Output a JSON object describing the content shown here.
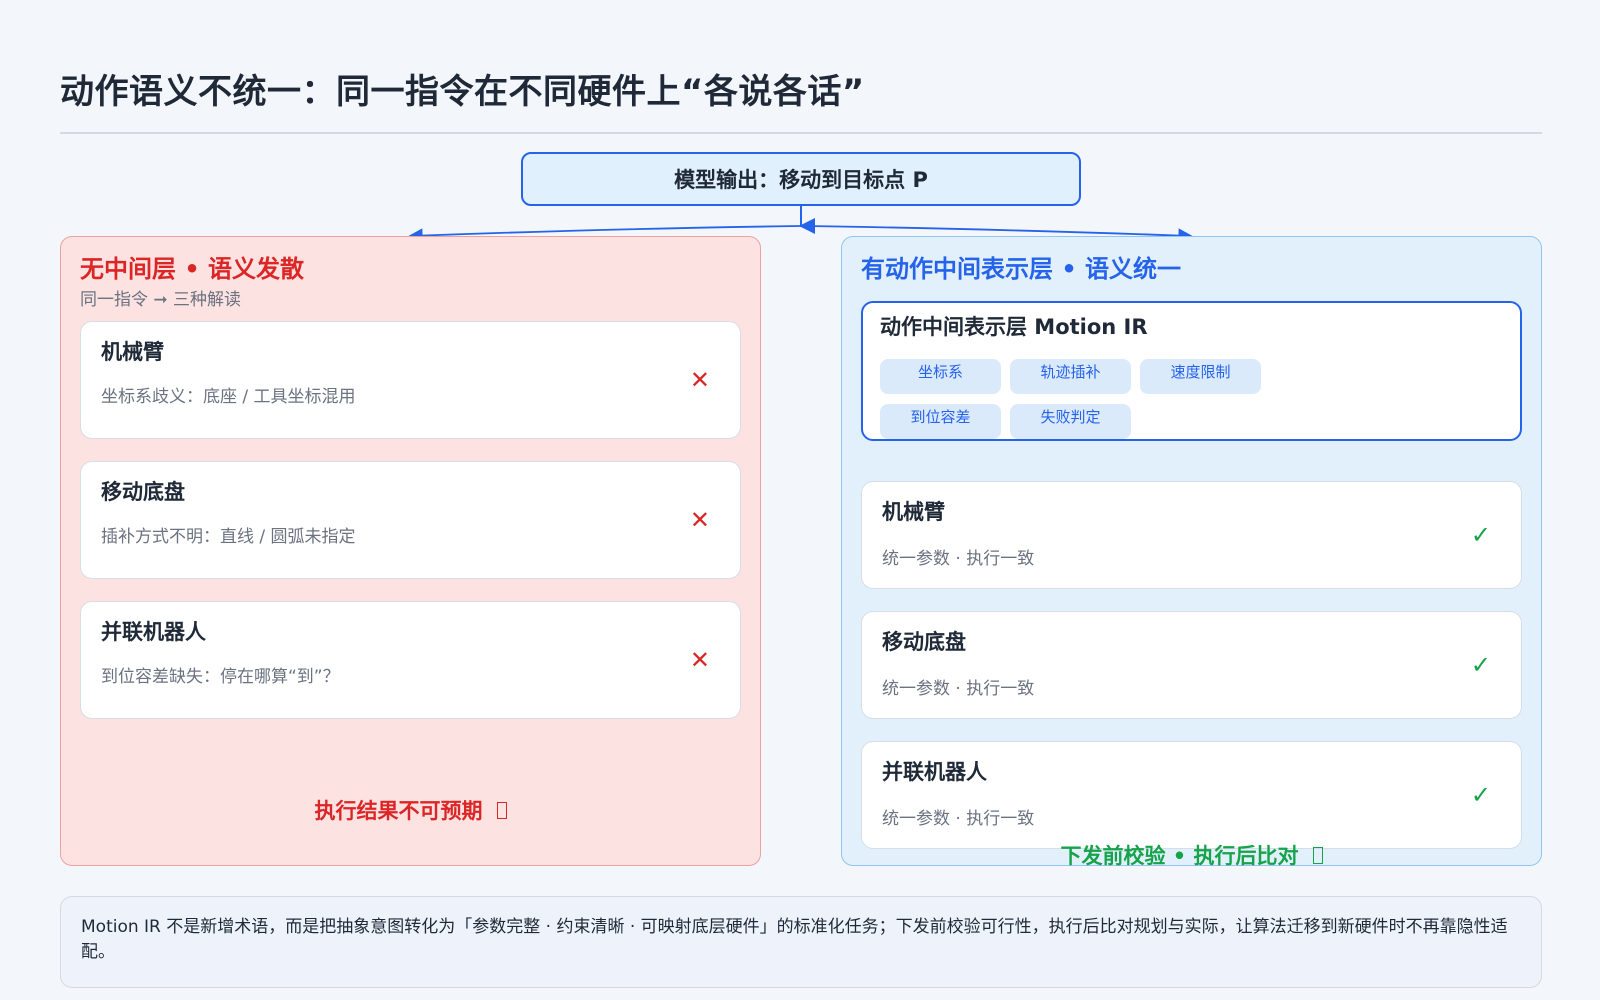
{
  "title": "动作语义不统一：同一指令在不同硬件上“各说各话”",
  "model_output": "模型输出：移动到目标点 P",
  "left_panel": {
    "heading": "无中间层 • 语义发散",
    "subtitle": "同一指令 ➞ 三种解读",
    "cards": [
      {
        "title": "机械臂",
        "desc": "坐标系歧义：底座 / 工具坐标混用",
        "mark": "✕"
      },
      {
        "title": "移动底盘",
        "desc": "插补方式不明：直线 / 圆弧未指定",
        "mark": "✕"
      },
      {
        "title": "并联机器人",
        "desc": "到位容差缺失：停在哪算“到”？",
        "mark": "✕"
      }
    ],
    "footer": "执行结果不可预期"
  },
  "right_panel": {
    "heading": "有动作中间表示层 • 语义统一",
    "ir": {
      "title": "动作中间表示层  Motion IR",
      "chips": [
        "坐标系",
        "轨迹插补",
        "速度限制",
        "到位容差",
        "失败判定"
      ]
    },
    "cards": [
      {
        "title": "机械臂",
        "desc": "统一参数 · 执行一致",
        "mark": "✓"
      },
      {
        "title": "移动底盘",
        "desc": "统一参数 · 执行一致",
        "mark": "✓"
      },
      {
        "title": "并联机器人",
        "desc": "统一参数 · 执行一致",
        "mark": "✓"
      }
    ],
    "footer": "下发前校验 • 执行后比对"
  },
  "note": "Motion IR 不是新增术语，而是把抽象意图转化为「参数完整 · 约束清晰 · 可映射底层硬件」的标准化任务；下发前校验可行性，执行后比对规划与实际，让算法迁移到新硬件时不再靠隐性适配。",
  "colors": {
    "accent_blue": "#2563eb",
    "error_red": "#dc2626",
    "success_green": "#16a34a"
  },
  "icons": {
    "fail": "cross-mark-icon",
    "pass": "check-mark-icon",
    "placeholder": "missing-glyph-icon"
  }
}
